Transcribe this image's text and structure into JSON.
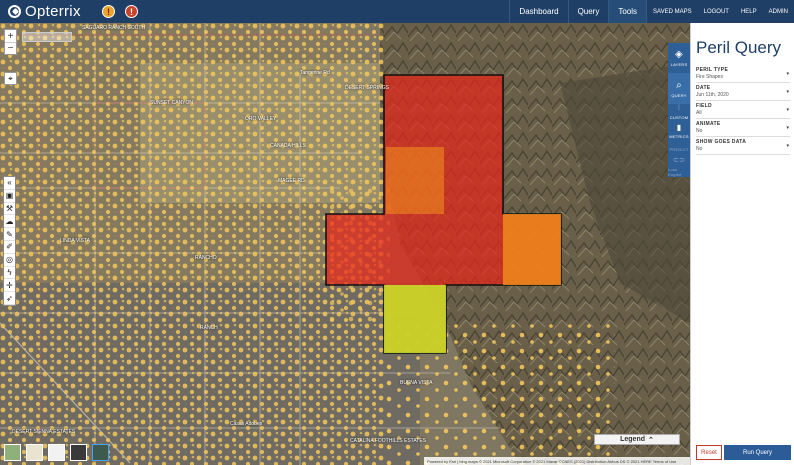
{
  "app": {
    "title": "Opterrix"
  },
  "nav": {
    "dashboard": "Dashboard",
    "query": "Query",
    "tools": "Tools",
    "saved_maps": "SAVED MAPS",
    "logout": "LOGOUT",
    "help": "HELP",
    "admin": "ADMIN"
  },
  "alerts": {
    "warning_glyph": "!"
  },
  "map": {
    "zoom_in": "+",
    "zoom_out": "−",
    "labels": {
      "ranch_south": "SAGUARO RANCH SOUTH",
      "sunset_canyon": "SUNSET CANYON",
      "desert_springs": "DESERT SPRINGS",
      "tangerine": "Tangerine Rd",
      "oro_valley": "ORO VALLEY",
      "catalina": "CATALINA FOOTHILLS ESTATES",
      "linda_vista": "LINDA VISTA",
      "sierra": "SIERRA",
      "estates": "ESTATES",
      "canada_hills": "CANADA HILLS",
      "rancho": "RANCHO",
      "ranch": "RANCH",
      "moore_blvd": "MAGEE RD",
      "adobe": "Casas Adobes",
      "buena": "BUENA VISTA",
      "desert_sierra": "DESERT SIENNA ESTATES"
    },
    "legend_label": "Legend",
    "attribution": "Powered by Esri  |  bing maps  © 2021 Microsoft Corporation © 2021 Maxar ©CNES (2021) Distribution Airbus DS © 2021 HERE  Terms of Use"
  },
  "side_strip": {
    "layers": "LAYERS",
    "query": "QUERY",
    "custom": "CUSTOM",
    "metrics": "METRICS",
    "predict": "PREDICT",
    "loss": "Loss Engine"
  },
  "panel": {
    "title": "Peril Query",
    "fields": [
      {
        "label": "PERIL TYPE",
        "value": "Fire Shapes"
      },
      {
        "label": "DATE",
        "value": "Jun 11th, 2020"
      },
      {
        "label": "FIELD",
        "value": "All"
      },
      {
        "label": "ANIMATE",
        "value": "No"
      },
      {
        "label": "SHOW GOES DATA",
        "value": "No"
      }
    ],
    "reset": "Reset",
    "run": "Run Query"
  },
  "colors": {
    "topbar": "#1f3f66",
    "accent": "#2b5c97",
    "fire_high": "#e8271b",
    "fire_mid": "#f08a1c",
    "fire_low": "#c8e12a",
    "property": "#f3c75a"
  }
}
